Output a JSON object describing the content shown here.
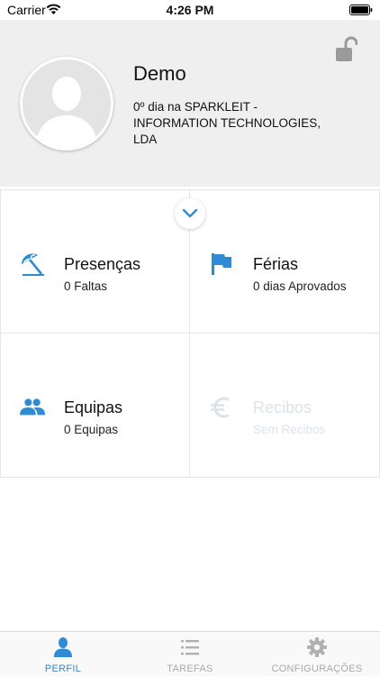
{
  "status_bar": {
    "carrier": "Carrier",
    "time": "4:26 PM"
  },
  "profile": {
    "name": "Demo",
    "description": "0º dia na SPARKLEIT - INFORMATION TECHNOLOGIES, LDA",
    "lock_icon": "unlocked-padlock-icon"
  },
  "tiles": [
    {
      "title": "Presenças",
      "subtitle": "0 Faltas",
      "icon": "beach-umbrella-icon",
      "enabled": true
    },
    {
      "title": "Férias",
      "subtitle": "0 dias Aprovados",
      "icon": "flag-icon",
      "enabled": true
    },
    {
      "title": "Equipas",
      "subtitle": "0 Equipas",
      "icon": "people-icon",
      "enabled": true
    },
    {
      "title": "Recibos",
      "subtitle": "Sem Recibos",
      "icon": "euro-icon",
      "enabled": false
    }
  ],
  "tab_bar": {
    "tabs": [
      {
        "label": "PERFIL",
        "icon": "person-icon",
        "active": true
      },
      {
        "label": "TAREFAS",
        "icon": "list-icon",
        "active": false
      },
      {
        "label": "CONFIGURAÇÕES",
        "icon": "gear-icon",
        "active": false
      }
    ]
  },
  "colors": {
    "accent": "#2f8bd3",
    "disabled": "#dde3ea",
    "header_bg": "#efefef"
  }
}
